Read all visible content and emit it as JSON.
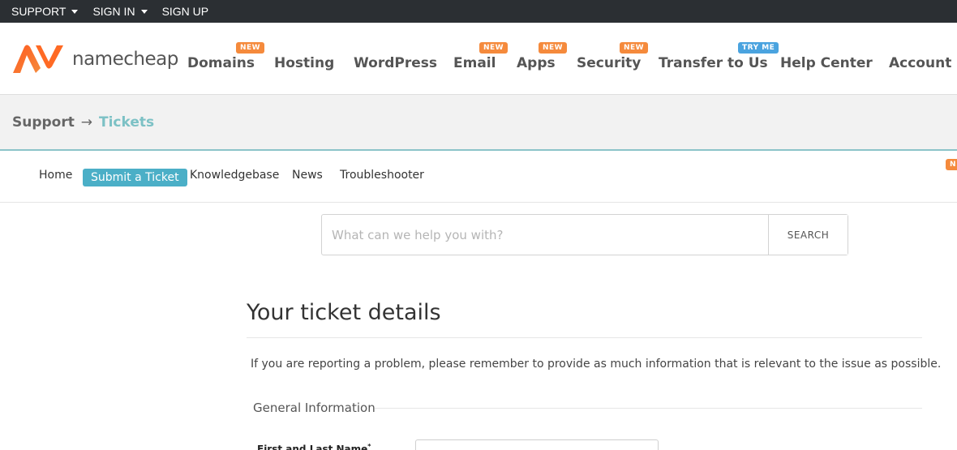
{
  "topbar": {
    "support": "SUPPORT",
    "sign_in": "SIGN IN",
    "sign_up": "SIGN UP"
  },
  "header": {
    "logo_text": "namecheap",
    "nav": [
      {
        "label": "Domains",
        "badge": "NEW"
      },
      {
        "label": "Hosting"
      },
      {
        "label": "WordPress"
      },
      {
        "label": "Email",
        "badge": "NEW"
      },
      {
        "label": "Apps",
        "badge": "NEW"
      },
      {
        "label": "Security",
        "badge": "NEW"
      },
      {
        "label": "Transfer to Us",
        "badge": "TRY ME"
      },
      {
        "label": "Help Center"
      },
      {
        "label": "Account"
      }
    ]
  },
  "breadcrumb": {
    "root": "Support",
    "arrow": "→",
    "current": "Tickets"
  },
  "subnav": {
    "items": [
      "Home",
      "Submit a Ticket",
      "Knowledgebase",
      "News",
      "Troubleshooter"
    ],
    "edge_badge": "N"
  },
  "search": {
    "placeholder": "What can we help you with?",
    "button": "SEARCH"
  },
  "ticket": {
    "title": "Your ticket details",
    "intro": "If you are reporting a problem, please remember to provide as much information that is relevant to the issue as possible.",
    "section": "General Information",
    "field_label": "First and Last Name",
    "required_mark": "*"
  },
  "colors": {
    "topbar_bg": "#2b2f33",
    "brand_orange": "#f58a3c",
    "badge_blue": "#4aa3df",
    "accent_teal": "#4bafc7",
    "breadcrumb_current": "#7cc1c5"
  }
}
